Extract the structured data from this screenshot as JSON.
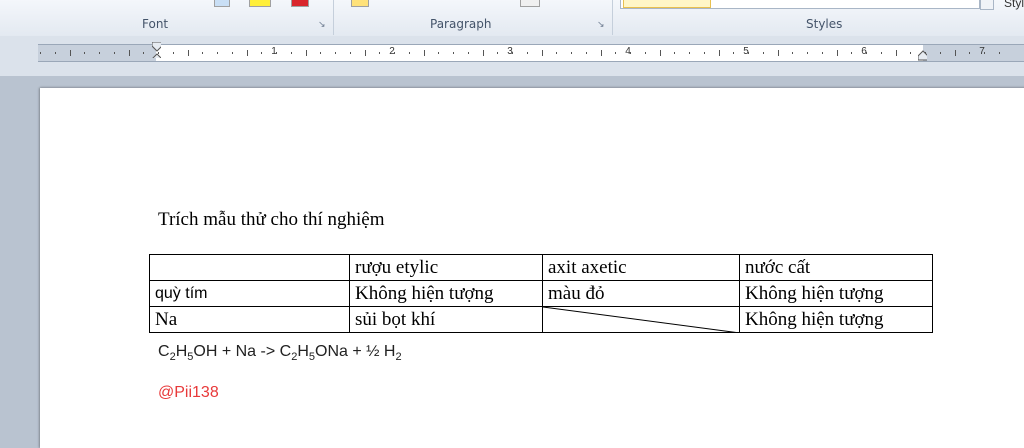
{
  "ribbon": {
    "groups": [
      {
        "label": "Font"
      },
      {
        "label": "Paragraph"
      },
      {
        "label": "Styles"
      }
    ],
    "styles_more_text": "Styl"
  },
  "ruler": {
    "numbers": [
      "1",
      "2",
      "3",
      "4",
      "5",
      "6",
      "7"
    ]
  },
  "document": {
    "heading": "Trích mẫu thử cho thí nghiệm",
    "table": {
      "rows": [
        [
          "",
          "rượu etylic",
          "axit axetic",
          "nước cất"
        ],
        [
          "quỳ tím",
          "Không hiện tượng",
          "màu đỏ",
          "Không hiện tượng"
        ],
        [
          "Na",
          "sủi bọt khí",
          "",
          "Không hiện tượng"
        ]
      ]
    },
    "equation": {
      "p1": "C",
      "s1": "2",
      "p2": "H",
      "s2": "5",
      "p3": "OH + Na -> C",
      "s3": "2",
      "p4": "H",
      "s4": "5",
      "p5": "ONa + ½ H",
      "s5": "2"
    },
    "handle": "@Pii138",
    "handle_color": "#e8393a"
  }
}
